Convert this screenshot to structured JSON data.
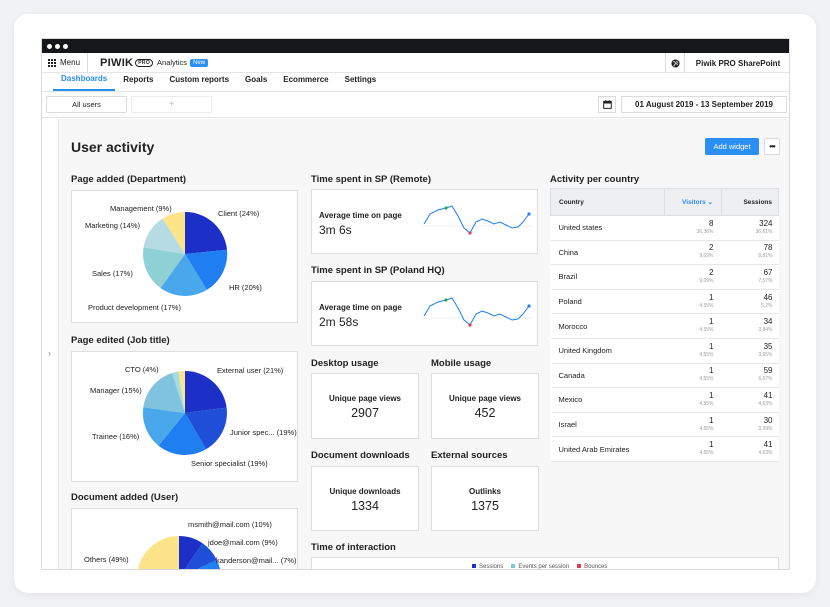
{
  "topbar": {
    "menu_label": "Menu",
    "logo_text": "PIWIK",
    "logo_badge": "PRO",
    "product": "Analytics",
    "new_badge": "New",
    "site_name": "Piwik PRO SharePoint"
  },
  "nav": {
    "items": [
      "Dashboards",
      "Reports",
      "Custom reports",
      "Goals",
      "Ecommerce",
      "Settings"
    ],
    "active": "Dashboards"
  },
  "filter": {
    "segment": "All users",
    "add_segment": "+",
    "date_range": "01 August 2019 - 13 September 2019"
  },
  "dashboard": {
    "title": "User activity",
    "add_widget_label": "Add widget",
    "more_label": "•••"
  },
  "colors": {
    "accent": "#2b8ef2",
    "pie1": "#1c2fc7",
    "pie2": "#1f7ff0",
    "pie3": "#49a8ec",
    "pie4": "#8ed0d6",
    "pie5": "#fde489",
    "spark_up": "#2fa84f",
    "spark_down": "#e23a4f"
  },
  "widgets": {
    "page_added": {
      "title": "Page added (Department)",
      "labels": {
        "management": "Management (9%)",
        "marketing": "Marketing (14%)",
        "client": "Client (24%)",
        "sales": "Sales (17%)",
        "hr": "HR (20%)",
        "product": "Product development (17%)"
      }
    },
    "page_edited": {
      "title": "Page edited (Job title)",
      "labels": {
        "cto": "CTO (4%)",
        "external": "External user (21%)",
        "manager": "Manager (15%)",
        "trainee": "Trainee (16%)",
        "junior": "Junior spec... (19%)",
        "senior": "Senior specialist (19%)"
      }
    },
    "doc_added": {
      "title": "Document added (User)",
      "labels": {
        "msmith": "msmith@mail.com (10%)",
        "jdoe": "jdoe@mail.com (9%)",
        "kanderson": "kanderson@mail... (7%)",
        "others": "Others (49%)"
      }
    },
    "time_remote": {
      "title": "Time spent in SP (Remote)",
      "label": "Average time on page",
      "value": "3m 6s"
    },
    "time_poland": {
      "title": "Time spent in SP (Poland HQ)",
      "label": "Average time on page",
      "value": "2m 58s"
    },
    "desktop": {
      "title": "Desktop usage",
      "label": "Unique page views",
      "value": "2907"
    },
    "mobile": {
      "title": "Mobile usage",
      "label": "Unique page views",
      "value": "452"
    },
    "downloads": {
      "title": "Document downloads",
      "label": "Unique downloads",
      "value": "1334"
    },
    "external": {
      "title": "External sources",
      "label": "Outlinks",
      "value": "1375"
    },
    "interaction": {
      "title": "Time of interaction",
      "legend": [
        "Sessions",
        "Events per session",
        "Bounces"
      ]
    }
  },
  "activity": {
    "title": "Activity per country",
    "headers": {
      "country": "Country",
      "visitors": "Visitors ⌄",
      "sessions": "Sessions"
    },
    "rows": [
      {
        "country": "United states",
        "visitors": "8",
        "visitors_pct": "36,36%",
        "sessions": "324",
        "sessions_pct": "36,61%"
      },
      {
        "country": "China",
        "visitors": "2",
        "visitors_pct": "9,09%",
        "sessions": "78",
        "sessions_pct": "8,81%"
      },
      {
        "country": "Brazil",
        "visitors": "2",
        "visitors_pct": "9,09%",
        "sessions": "67",
        "sessions_pct": "7,57%"
      },
      {
        "country": "Poland",
        "visitors": "1",
        "visitors_pct": "4,55%",
        "sessions": "46",
        "sessions_pct": "5,2%"
      },
      {
        "country": "Morocco",
        "visitors": "1",
        "visitors_pct": "4,55%",
        "sessions": "34",
        "sessions_pct": "3,84%"
      },
      {
        "country": "United Kingdom",
        "visitors": "1",
        "visitors_pct": "4,55%",
        "sessions": "35",
        "sessions_pct": "3,95%"
      },
      {
        "country": "Canada",
        "visitors": "1",
        "visitors_pct": "4,55%",
        "sessions": "59",
        "sessions_pct": "6,67%"
      },
      {
        "country": "Mexico",
        "visitors": "1",
        "visitors_pct": "4,55%",
        "sessions": "41",
        "sessions_pct": "4,63%"
      },
      {
        "country": "Israel",
        "visitors": "1",
        "visitors_pct": "4,55%",
        "sessions": "30",
        "sessions_pct": "3,39%"
      },
      {
        "country": "United Arab Emirates",
        "visitors": "1",
        "visitors_pct": "4,55%",
        "sessions": "41",
        "sessions_pct": "4,63%"
      }
    ]
  }
}
